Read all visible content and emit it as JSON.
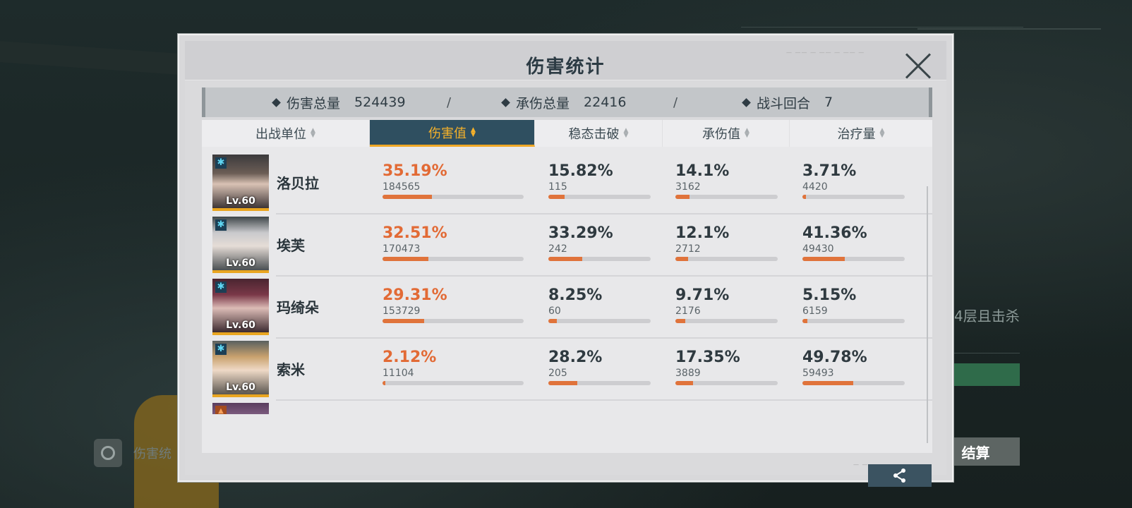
{
  "background": {
    "side_text": "4层且击杀",
    "settle_button": "结算",
    "back_label": "伤害统"
  },
  "modal": {
    "title": "伤害统计",
    "summary": [
      {
        "label": "伤害总量",
        "value": "524439"
      },
      {
        "label": "承伤总量",
        "value": "22416"
      },
      {
        "label": "战斗回合",
        "value": "7"
      }
    ],
    "separator": "/",
    "columns": [
      {
        "label": "出战单位",
        "active": false
      },
      {
        "label": "伤害值",
        "active": true
      },
      {
        "label": "稳态击破",
        "active": false
      },
      {
        "label": "承伤值",
        "active": false
      },
      {
        "label": "治疗量",
        "active": false
      }
    ],
    "rows": [
      {
        "name": "洛贝拉",
        "level": "Lv.60",
        "damage": {
          "pct": "35.19%",
          "value": "184565",
          "fraction": 0.3519
        },
        "break": {
          "pct": "15.82%",
          "value": "115",
          "fraction": 0.1582
        },
        "taken": {
          "pct": "14.1%",
          "value": "3162",
          "fraction": 0.141
        },
        "heal": {
          "pct": "3.71%",
          "value": "4420",
          "fraction": 0.0371
        }
      },
      {
        "name": "埃芙",
        "level": "Lv.60",
        "damage": {
          "pct": "32.51%",
          "value": "170473",
          "fraction": 0.3251
        },
        "break": {
          "pct": "33.29%",
          "value": "242",
          "fraction": 0.3329
        },
        "taken": {
          "pct": "12.1%",
          "value": "2712",
          "fraction": 0.121
        },
        "heal": {
          "pct": "41.36%",
          "value": "49430",
          "fraction": 0.4136
        }
      },
      {
        "name": "玛绮朵",
        "level": "Lv.60",
        "damage": {
          "pct": "29.31%",
          "value": "153729",
          "fraction": 0.2931
        },
        "break": {
          "pct": "8.25%",
          "value": "60",
          "fraction": 0.0825
        },
        "taken": {
          "pct": "9.71%",
          "value": "2176",
          "fraction": 0.0971
        },
        "heal": {
          "pct": "5.15%",
          "value": "6159",
          "fraction": 0.0515
        }
      },
      {
        "name": "索米",
        "level": "Lv.60",
        "damage": {
          "pct": "2.12%",
          "value": "11104",
          "fraction": 0.0212
        },
        "break": {
          "pct": "28.2%",
          "value": "205",
          "fraction": 0.282
        },
        "taken": {
          "pct": "17.35%",
          "value": "3889",
          "fraction": 0.1735
        },
        "heal": {
          "pct": "49.78%",
          "value": "59493",
          "fraction": 0.4978
        }
      }
    ],
    "colors": {
      "accent_orange": "#e26a35",
      "active_tab_bg": "#2f4f60",
      "active_tab_text": "#f5b12a",
      "bar_fill": "#e0733b"
    },
    "icons": {
      "close": "close-icon",
      "share": "share-icon",
      "element": "ice-element-icon"
    }
  }
}
